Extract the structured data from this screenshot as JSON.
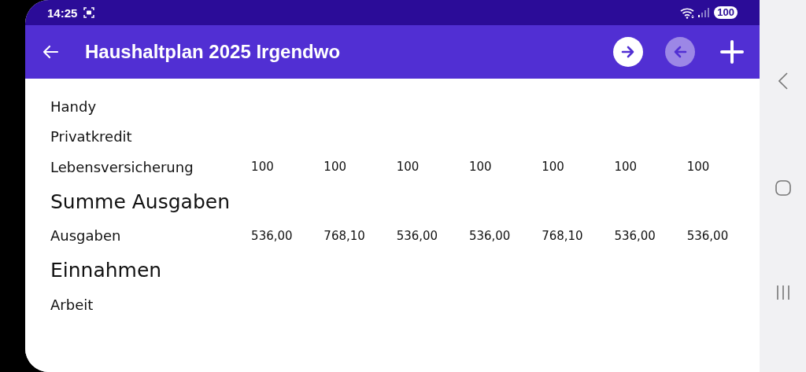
{
  "status_bar": {
    "time": "14:25",
    "battery": "100"
  },
  "app_bar": {
    "title": "Haushaltplan 2025 Irgendwo",
    "actions": [
      {
        "kind": "forward",
        "disabled": false
      },
      {
        "kind": "back",
        "disabled": true
      },
      {
        "kind": "add",
        "disabled": false
      }
    ]
  },
  "rows": [
    {
      "kind": "row",
      "label": "Handy",
      "values": []
    },
    {
      "kind": "row",
      "label": "Privatkredit",
      "values": []
    },
    {
      "kind": "row",
      "label": "Lebensversicherung",
      "values": [
        "100",
        "100",
        "100",
        "100",
        "100",
        "100",
        "100"
      ]
    },
    {
      "kind": "heading",
      "label": "Summe Ausgaben",
      "values": []
    },
    {
      "kind": "row",
      "label": "Ausgaben",
      "values": [
        "536,00",
        "768,10",
        "536,00",
        "536,00",
        "768,10",
        "536,00",
        "536,00"
      ]
    },
    {
      "kind": "heading",
      "label": "Einnahmen",
      "values": []
    },
    {
      "kind": "row",
      "label": "Arbeit",
      "values": []
    }
  ]
}
